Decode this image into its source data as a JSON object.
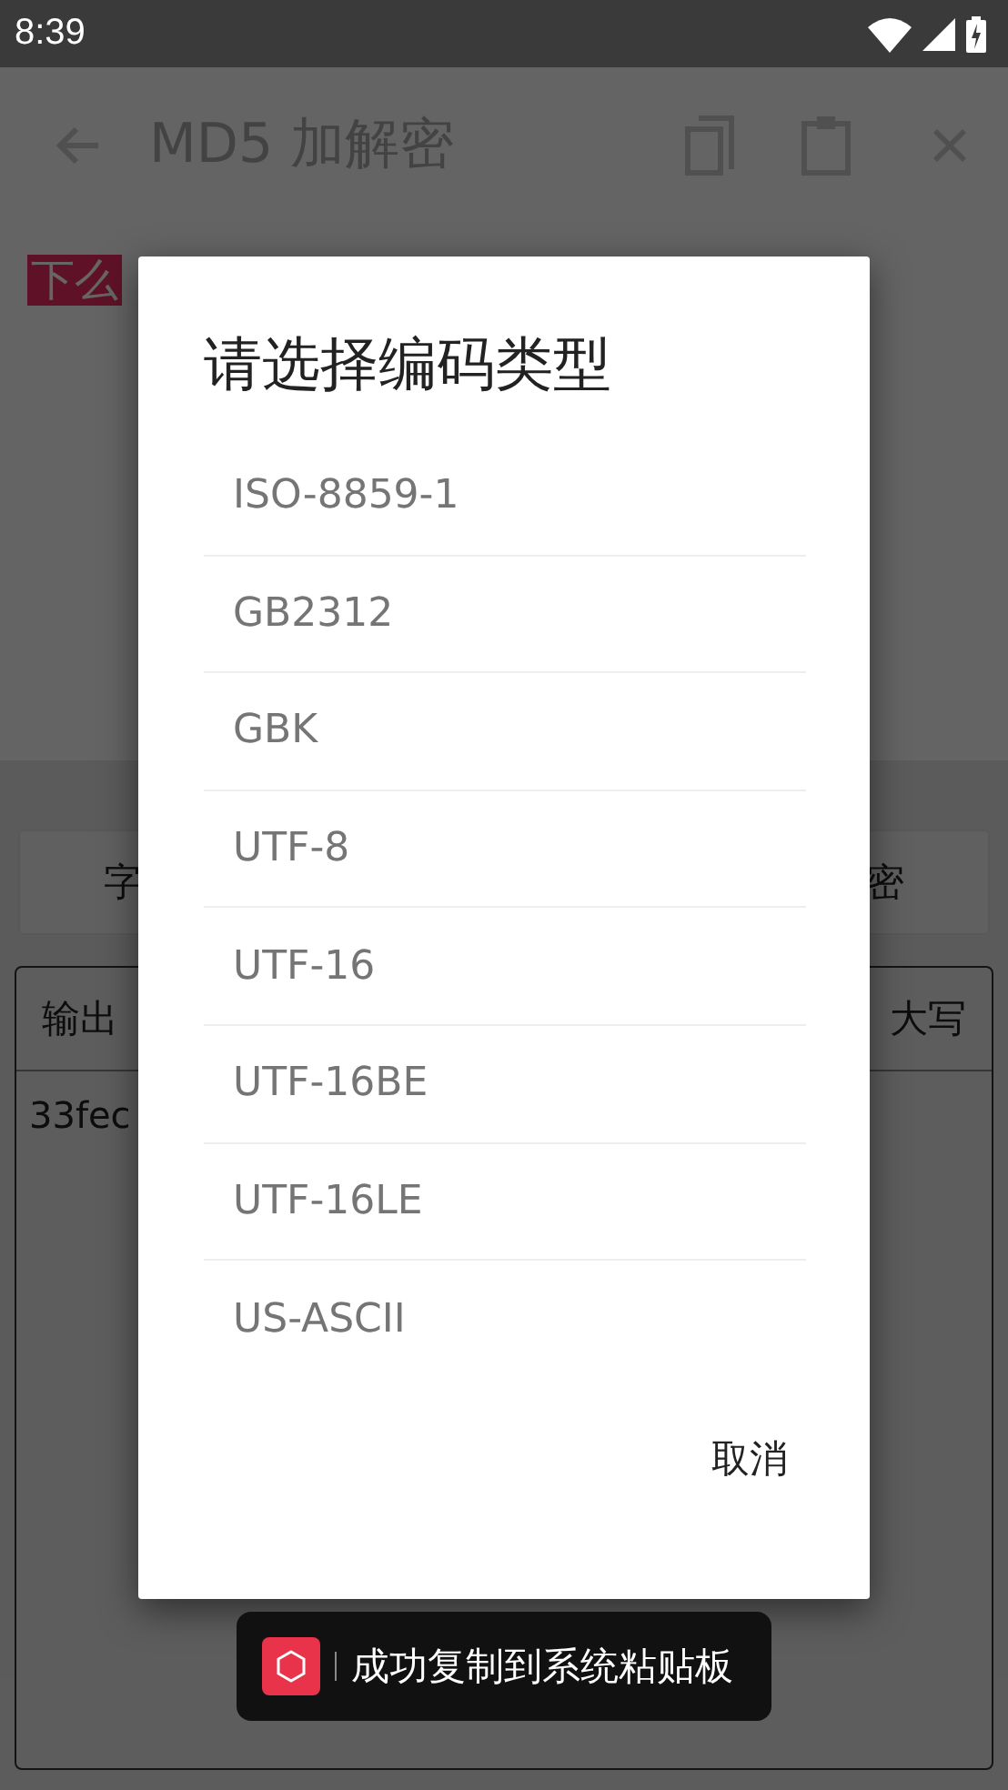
{
  "status_bar": {
    "time": "8:39"
  },
  "app_bar": {
    "title": "MD5 加解密"
  },
  "input": {
    "text": "下么",
    "highlighted": true
  },
  "buttons": [
    "字",
    "密"
  ],
  "output": {
    "label": "输出",
    "case_toggle": "大写",
    "value": "33fec"
  },
  "dialog": {
    "title": "请选择编码类型",
    "options": [
      "ISO-8859-1",
      "GB2312",
      "GBK",
      "UTF-8",
      "UTF-16",
      "UTF-16BE",
      "UTF-16LE",
      "US-ASCII"
    ],
    "cancel": "取消"
  },
  "toast": {
    "text": "成功复制到系统粘贴板"
  }
}
